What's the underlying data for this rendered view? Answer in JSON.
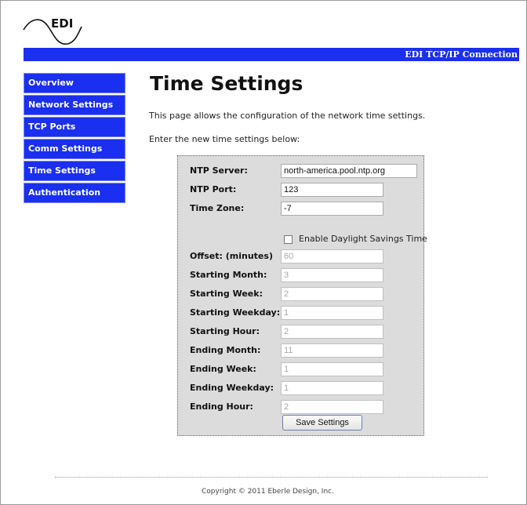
{
  "logo": {
    "text": "EDI"
  },
  "header": {
    "title": "EDI TCP/IP Connection"
  },
  "sidebar": {
    "items": [
      {
        "label": "Overview"
      },
      {
        "label": "Network Settings"
      },
      {
        "label": "TCP Ports"
      },
      {
        "label": "Comm Settings"
      },
      {
        "label": "Time Settings"
      },
      {
        "label": "Authentication"
      }
    ]
  },
  "main": {
    "title": "Time Settings",
    "intro": "This page allows the configuration of the network time settings.",
    "prompt": "Enter the new time settings below:"
  },
  "form": {
    "ntp_server": {
      "label": "NTP Server:",
      "value": "north-america.pool.ntp.org"
    },
    "ntp_port": {
      "label": "NTP Port:",
      "value": "123"
    },
    "time_zone": {
      "label": "Time Zone:",
      "value": "-7"
    },
    "dst": {
      "label": "Enable Daylight Savings Time",
      "checked": false
    },
    "offset": {
      "label": "Offset: (minutes)",
      "value": "60"
    },
    "start_month": {
      "label": "Starting Month:",
      "value": "3"
    },
    "start_week": {
      "label": "Starting Week:",
      "value": "2"
    },
    "start_weekday": {
      "label": "Starting Weekday:",
      "value": "1"
    },
    "start_hour": {
      "label": "Starting Hour:",
      "value": "2"
    },
    "end_month": {
      "label": "Ending Month:",
      "value": "11"
    },
    "end_week": {
      "label": "Ending Week:",
      "value": "1"
    },
    "end_weekday": {
      "label": "Ending Weekday:",
      "value": "1"
    },
    "end_hour": {
      "label": "Ending Hour:",
      "value": "2"
    },
    "save_label": "Save Settings"
  },
  "footer": {
    "copyright": "Copyright © 2011 Eberle Design, Inc."
  },
  "colors": {
    "accent": "#1a2ff0",
    "form_bg": "#dcdcdc"
  }
}
